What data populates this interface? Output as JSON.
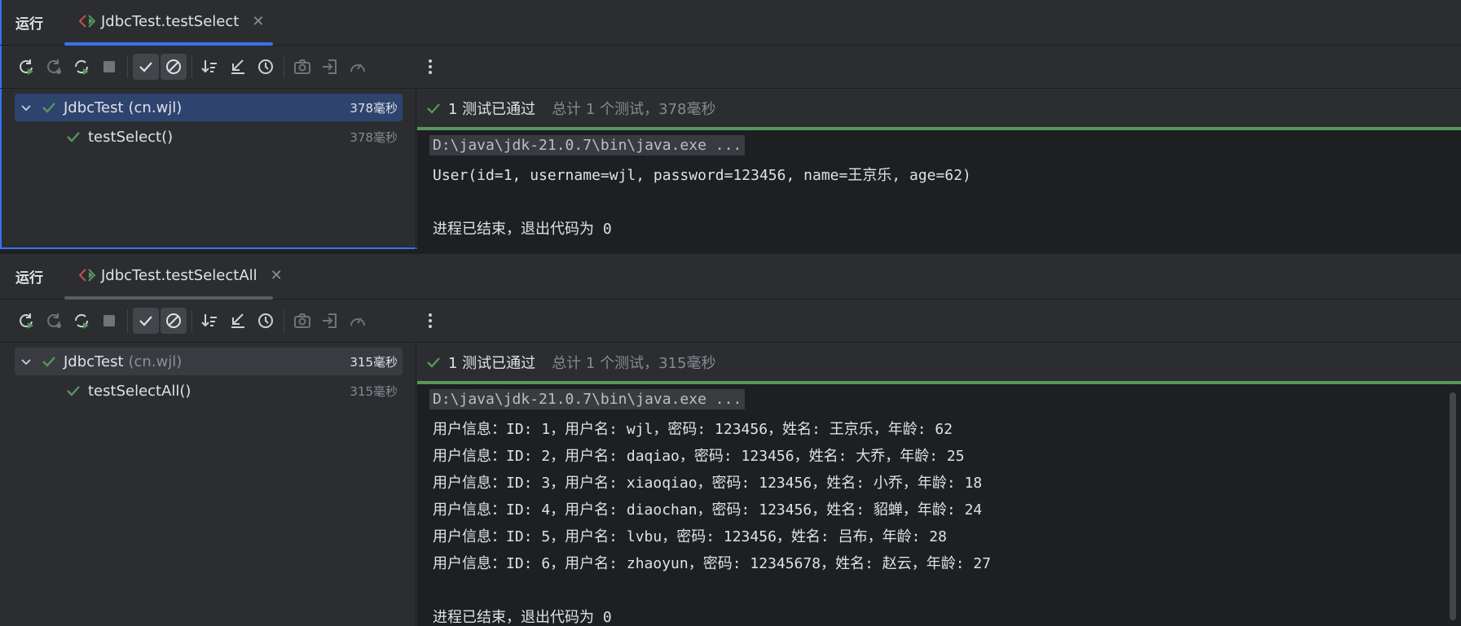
{
  "panels": [
    {
      "run_label": "运行",
      "tab": {
        "title": "JdbcTest.testSelect",
        "close": "✕"
      },
      "tree": {
        "root": {
          "name": "JdbcTest",
          "package": "(cn.wjl)",
          "time": "378毫秒"
        },
        "child": {
          "name": "testSelect()",
          "time": "378毫秒"
        }
      },
      "status": {
        "main": "1 测试已通过",
        "sub": "总计 1 个测试，378毫秒"
      },
      "output": {
        "command": "D:\\java\\jdk-21.0.7\\bin\\java.exe ...",
        "lines": [
          "User(id=1, username=wjl, password=123456, name=王京乐, age=62)"
        ],
        "exit": "进程已结束，退出代码为 0"
      }
    },
    {
      "run_label": "运行",
      "tab": {
        "title": "JdbcTest.testSelectAll",
        "close": "✕"
      },
      "tree": {
        "root": {
          "name": "JdbcTest",
          "package": "(cn.wjl)",
          "time": "315毫秒"
        },
        "child": {
          "name": "testSelectAll()",
          "time": "315毫秒"
        }
      },
      "status": {
        "main": "1 测试已通过",
        "sub": "总计 1 个测试，315毫秒"
      },
      "output": {
        "command": "D:\\java\\jdk-21.0.7\\bin\\java.exe ...",
        "lines": [
          "用户信息：ID: 1，用户名: wjl，密码: 123456，姓名: 王京乐，年龄: 62",
          "用户信息：ID: 2，用户名: daqiao，密码: 123456，姓名: 大乔，年龄: 25",
          "用户信息：ID: 3，用户名: xiaoqiao，密码: 123456，姓名: 小乔，年龄: 18",
          "用户信息：ID: 4，用户名: diaochan，密码: 123456，姓名: 貂蝉，年龄: 24",
          "用户信息：ID: 5，用户名: lvbu，密码: 123456，姓名: 吕布，年龄: 28",
          "用户信息：ID: 6，用户名: zhaoyun，密码: 12345678，姓名: 赵云，年龄: 27"
        ],
        "exit": "进程已结束，退出代码为 0"
      }
    }
  ],
  "colors": {
    "accent": "#3574f0",
    "pass": "#57965c",
    "bg": "#2b2d30",
    "console": "#1e1f22"
  }
}
